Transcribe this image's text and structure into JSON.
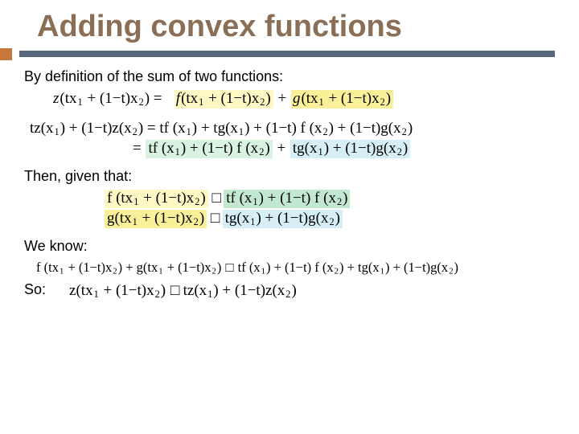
{
  "title": "Adding convex functions",
  "p1": "By definition of the sum of two functions:",
  "eq1": {
    "lhs_z": "z",
    "arg": "(tx",
    "s1": "1",
    "mid": " + (1−t)x",
    "s2": "2",
    "close": ") =",
    "f": "f",
    "fopen": "(tx",
    "fs1": "1",
    "fmid": " + (1−t)x",
    "fs2": "2",
    "fclose": ")",
    "plus": "+",
    "g": "g",
    "gopen": "(tx",
    "gs1": "1",
    "gmid": " + (1−t)x",
    "gs2": "2",
    "gclose": ")"
  },
  "eq2a": {
    "lhs_pre": "tz(x",
    "s1": "1",
    "mid1": ") + (1−t)z(x",
    "s2": "2",
    "mid2": ") = tf (x",
    "s3": "1",
    "mid3": ") + tg(x",
    "s4": "1",
    "mid4": ") + (1−t) f (x",
    "s5": "2",
    "mid5": ") + (1−t)g(x",
    "s6": "2",
    "end": ")"
  },
  "eq2b": {
    "eq_sign": "=",
    "g1a": "tf (x",
    "g1s1": "1",
    "g1b": ") + (1−t) f (x",
    "g1s2": "2",
    "g1c": ")",
    "plus": "+",
    "b1a": "tg(x",
    "b1s1": "1",
    "b1b": ") + (1−t)g(x",
    "b1s2": "2",
    "b1c": ")"
  },
  "p2": "Then, given that:",
  "eq3a": {
    "y_a": "f (tx",
    "y_s1": "1",
    "y_b": " + (1−t)x",
    "y_s2": "2",
    "y_c": ")",
    "rel": "□",
    "g_a": "tf (x",
    "g_s1": "1",
    "g_b": ") + (1−t) f (x",
    "g_s2": "2",
    "g_c": ")"
  },
  "eq3b": {
    "y_a": "g(tx",
    "y_s1": "1",
    "y_b": " + (1−t)x",
    "y_s2": "2",
    "y_c": ")",
    "rel": "□",
    "b_a": "tg(x",
    "b_s1": "1",
    "b_b": ") + (1−t)g(x",
    "b_s2": "2",
    "b_c": ")"
  },
  "p3": "We know:",
  "eq4": {
    "a": "f (tx",
    "s1": "1",
    "b": " + (1−t)x",
    "s2": "2",
    "c": ") + g(tx",
    "s3": "1",
    "d": " + (1−t)x",
    "s4": "2",
    "e": ")",
    "rel": "□",
    "f": "tf (x",
    "s5": "1",
    "g": ") + (1−t) f (x",
    "s6": "2",
    "h": ") + tg(x",
    "s7": "1",
    "i": ") + (1−t)g(x",
    "s8": "2",
    "j": ")"
  },
  "p4": "So:",
  "eq5": {
    "a": "z(tx",
    "s1": "1",
    "b": " + (1−t)x",
    "s2": "2",
    "c": ")",
    "rel": "□",
    "d": "tz(x",
    "s3": "1",
    "e": ") + (1−t)z(x",
    "s4": "2",
    "f": ")"
  }
}
